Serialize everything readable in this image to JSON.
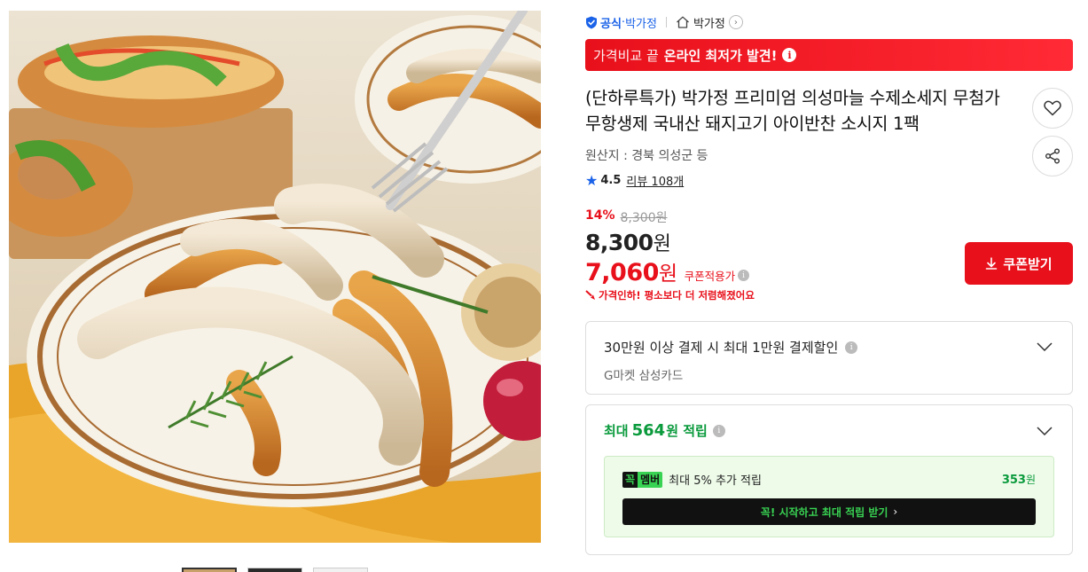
{
  "seller": {
    "official_label": "공식",
    "dot": "·",
    "seller_name": "박가정",
    "store_name": "박가정"
  },
  "promo": {
    "light": "가격비교 끝",
    "strong": "온라인 최저가 발견!",
    "info": "i"
  },
  "product": {
    "title": "(단하루특가) 박가정 프리미엄 의성마늘 수제소세지 무첨가 무항생제 국내산 돼지고기 아이반찬 소시지 1팩",
    "origin": "원산지 : 경북 의성군 등",
    "rating": "4.5",
    "reviews": "리뷰 108개"
  },
  "price": {
    "discount_rate": "14%",
    "original": "8,300원",
    "sale_value": "8,300",
    "sale_unit": "원",
    "coupon_value": "7,060",
    "coupon_unit": "원",
    "coupon_label": "쿠폰적용가",
    "price_drop": "가격인하! 평소보다 더 저렴해졌어요",
    "coupon_button": "쿠폰받기"
  },
  "card_benefit": {
    "title": "30만원 이상 결제 시 최대 1만원 결제할인",
    "sub": "G마켓 삼성카드"
  },
  "points": {
    "prefix": "최대",
    "amount": "564",
    "suffix": "원 적립",
    "member_k": "꼭",
    "member_m": "멤버",
    "member_desc": "최대 5% 추가 적립",
    "member_points": "353",
    "member_unit": "원",
    "cta": "꼭! 시작하고 최대 적립 받기",
    "cta_chevron": "›"
  },
  "colors": {
    "accent_red": "#e8101b",
    "brand_blue": "#1a62e8",
    "points_green": "#0a9a3c",
    "member_green": "#39d353"
  },
  "icons": [
    "shield-check-icon",
    "home-icon",
    "chevron-right-icon",
    "info-icon",
    "heart-icon",
    "share-icon",
    "star-icon",
    "download-icon",
    "chevron-down-icon",
    "price-drop-icon"
  ]
}
